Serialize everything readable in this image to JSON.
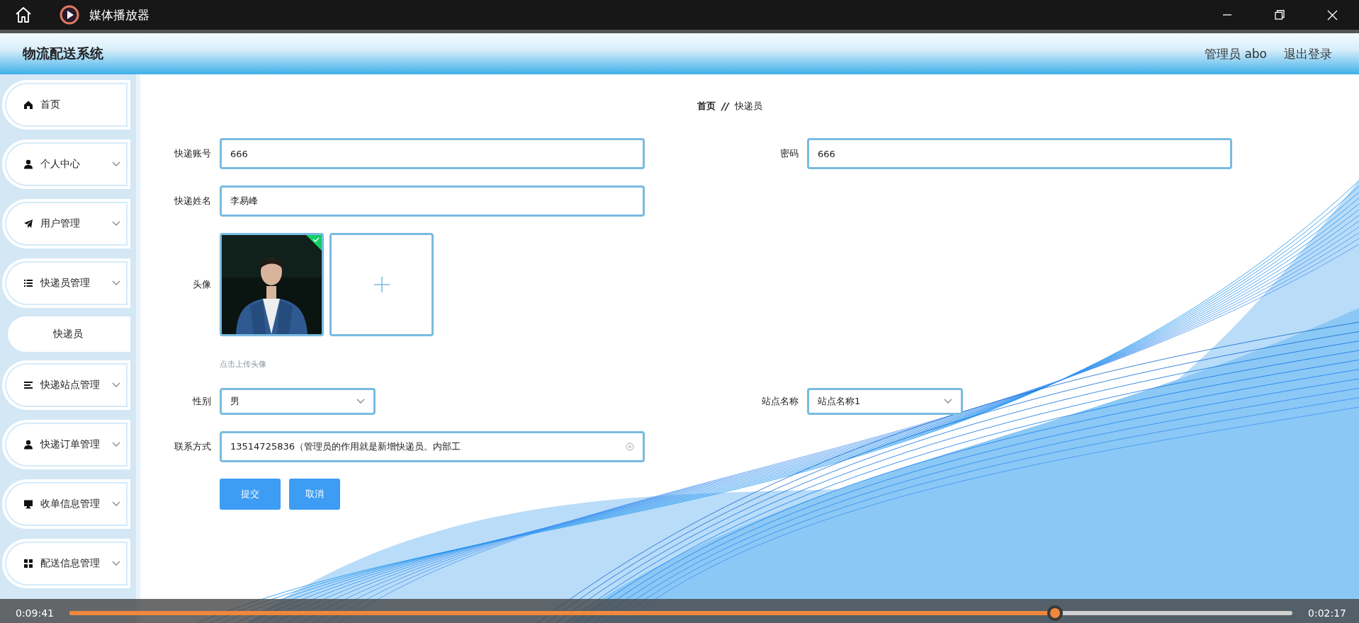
{
  "player": {
    "title": "媒体播放器",
    "elapsed": "0:09:41",
    "remaining": "0:02:17",
    "level": 0.806
  },
  "header": {
    "title": "物流配送系统",
    "user": "管理员 abo",
    "logout": "退出登录"
  },
  "sidebar": {
    "items": [
      {
        "label": "首页",
        "expandable": false
      },
      {
        "label": "个人中心",
        "expandable": true
      },
      {
        "label": "用户管理",
        "expandable": true
      },
      {
        "label": "快递员管理",
        "expandable": true,
        "children": [
          {
            "label": "快递员"
          }
        ]
      },
      {
        "label": "快递站点管理",
        "expandable": true
      },
      {
        "label": "快递订单管理",
        "expandable": true
      },
      {
        "label": "收单信息管理",
        "expandable": true
      },
      {
        "label": "配送信息管理",
        "expandable": true
      }
    ]
  },
  "breadcrumb": {
    "items": [
      "首页",
      "快递员"
    ],
    "separator": "//"
  },
  "form": {
    "rows": [
      [
        {
          "kind": "text",
          "label": "快递账号",
          "value": "666"
        },
        {
          "kind": "text",
          "label": "密码",
          "value": "666"
        }
      ],
      [
        {
          "kind": "text",
          "label": "快递姓名",
          "value": "李易峰"
        }
      ],
      [
        {
          "kind": "avatar",
          "label": "头像",
          "hint": "点击上传头像"
        }
      ],
      [
        {
          "kind": "select",
          "label": "性别",
          "value": "男"
        },
        {
          "kind": "select",
          "label": "站点名称",
          "value": "站点名称1"
        }
      ],
      [
        {
          "kind": "text",
          "label": "联系方式",
          "value": "13514725836（管理员的作用就是新增快递员。内部工",
          "clearable": true
        }
      ]
    ],
    "buttons": [
      "提交",
      "取消"
    ]
  }
}
